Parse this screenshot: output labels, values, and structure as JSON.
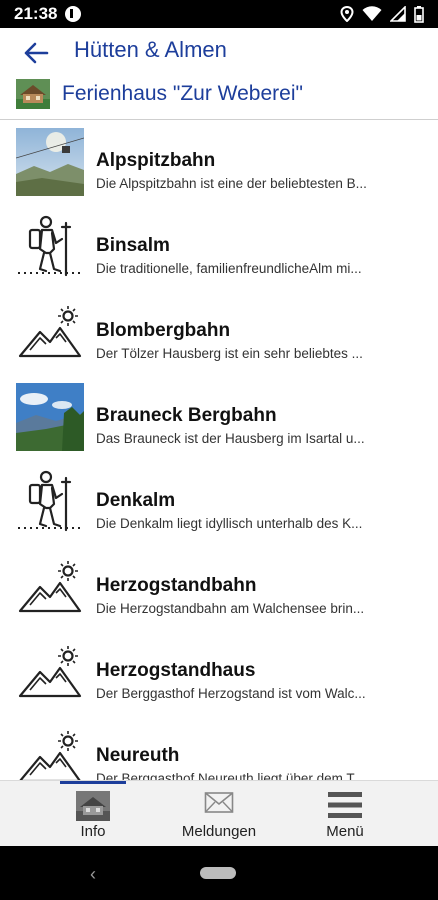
{
  "status_bar": {
    "time": "21:38",
    "icons": [
      "app-notification-icon",
      "location-icon",
      "wifi-icon",
      "signal-icon",
      "battery-icon"
    ]
  },
  "header": {
    "back_icon": "arrow-left-icon",
    "title": "Hütten & Almen",
    "context_title": "Ferienhaus \"Zur Weberei\""
  },
  "list": {
    "items": [
      {
        "title": "Alpspitzbahn",
        "description": "Die Alpspitzbahn ist eine der beliebtesten B...",
        "icon": "photo-cable-car"
      },
      {
        "title": "Binsalm",
        "description": "Die traditionelle, familienfreundlicheAlm mi...",
        "icon": "hiker-icon"
      },
      {
        "title": "Blombergbahn",
        "description": "Der Tölzer Hausberg ist ein sehr beliebtes ...",
        "icon": "mountain-sun-icon"
      },
      {
        "title": "Brauneck Bergbahn",
        "description": "Das Brauneck ist der Hausberg im Isartal u...",
        "icon": "photo-landscape"
      },
      {
        "title": "Denkalm",
        "description": "Die Denkalm liegt idyllisch unterhalb des K...",
        "icon": "hiker-icon"
      },
      {
        "title": "Herzogstandbahn",
        "description": "Die Herzogstandbahn am Walchensee brin...",
        "icon": "mountain-sun-icon"
      },
      {
        "title": "Herzogstandhaus",
        "description": "Der Berggasthof Herzogstand ist vom Walc...",
        "icon": "mountain-sun-icon"
      },
      {
        "title": "Neureuth",
        "description": "Der Berggasthof Neureuth liegt über dem T...",
        "icon": "mountain-sun-icon"
      }
    ]
  },
  "bottom_nav": {
    "items": [
      {
        "label": "Info",
        "icon": "house-thumbnail-icon",
        "active": true
      },
      {
        "label": "Meldungen",
        "icon": "envelope-icon",
        "active": false
      },
      {
        "label": "Menü",
        "icon": "hamburger-menu-icon",
        "active": false
      }
    ],
    "accent": "#1d3e9b"
  },
  "colors": {
    "accent": "#1d3e9b",
    "status_bar": "#000000",
    "nav_bar": "#f2f2f2"
  }
}
